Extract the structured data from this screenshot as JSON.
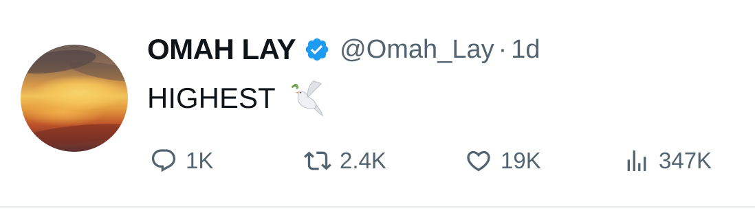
{
  "tweet": {
    "author": {
      "display_name": "OMAH LAY",
      "handle": "@Omah_Lay",
      "verified": true,
      "avatar": "sunset-sky-painting"
    },
    "separator": "·",
    "time": "1d",
    "text": "HIGHEST",
    "emoji": "dove-icon",
    "stats": {
      "replies": "1K",
      "retweets": "2.4K",
      "likes": "19K",
      "views": "347K"
    }
  },
  "colors": {
    "text": "#0f1419",
    "secondary": "#536471",
    "verified_badge": "#1d9bf0",
    "divider": "#e6e9ec"
  }
}
